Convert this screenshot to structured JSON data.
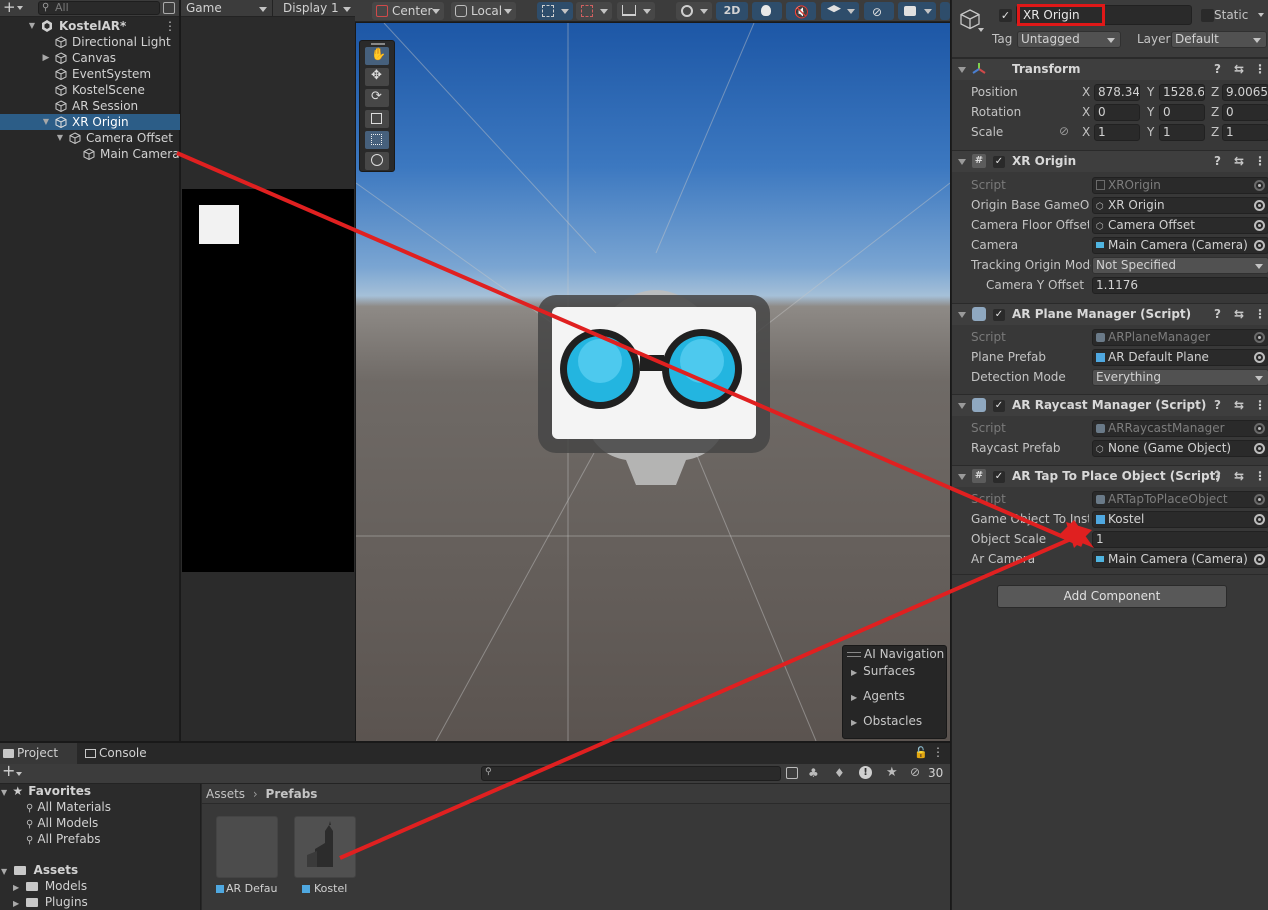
{
  "hierarchy": {
    "search_placeholder": "All",
    "scene_name": "KostelAR*",
    "items": [
      {
        "label": "Directional Light"
      },
      {
        "label": "Canvas"
      },
      {
        "label": "EventSystem"
      },
      {
        "label": "KostelScene"
      },
      {
        "label": "AR Session"
      },
      {
        "label": "XR Origin"
      },
      {
        "label": "Camera Offset"
      },
      {
        "label": "Main Camera"
      }
    ]
  },
  "game_view": {
    "tab": "Game",
    "display": "Display 1"
  },
  "scene_toolbar": {
    "pivot": "Center",
    "space": "Local",
    "mode_2d": "2D"
  },
  "ai_navigation": {
    "title": "AI Navigation",
    "items": [
      "Surfaces",
      "Agents",
      "Obstacles"
    ]
  },
  "inspector": {
    "object_name": "XR Origin",
    "static_label": "Static",
    "tag_label": "Tag",
    "tag_value": "Untagged",
    "layer_label": "Layer",
    "layer_value": "Default",
    "transform": {
      "title": "Transform",
      "position_label": "Position",
      "rotation_label": "Rotation",
      "scale_label": "Scale",
      "position": {
        "x": "878.34",
        "y": "1528.62",
        "z": "9.0065"
      },
      "rotation": {
        "x": "0",
        "y": "0",
        "z": "0"
      },
      "scale": {
        "x": "1",
        "y": "1",
        "z": "1"
      }
    },
    "xr_origin": {
      "title": "XR Origin",
      "script_label": "Script",
      "script_value": "XROrigin",
      "origin_label": "Origin Base GameObj",
      "origin_value": "XR Origin",
      "floor_label": "Camera Floor Offset O",
      "floor_value": "Camera Offset",
      "camera_label": "Camera",
      "camera_value": "Main Camera (Camera)",
      "tracking_label": "Tracking Origin Mode",
      "tracking_value": "Not Specified",
      "yoffset_label": "Camera Y Offset",
      "yoffset_value": "1.1176"
    },
    "plane_manager": {
      "title": "AR Plane Manager (Script)",
      "script_label": "Script",
      "script_value": "ARPlaneManager",
      "prefab_label": "Plane Prefab",
      "prefab_value": "AR Default Plane",
      "detection_label": "Detection Mode",
      "detection_value": "Everything"
    },
    "raycast_manager": {
      "title": "AR Raycast Manager (Script)",
      "script_label": "Script",
      "script_value": "ARRaycastManager",
      "prefab_label": "Raycast Prefab",
      "prefab_value": "None (Game Object)"
    },
    "tap_to_place": {
      "title": "AR Tap To Place Object (Script)",
      "script_label": "Script",
      "script_value": "ARTapToPlaceObject",
      "go_label": "Game Object To Insta",
      "go_value": "Kostel",
      "scale_label": "Object Scale",
      "scale_value": "1",
      "camera_label": "Ar Camera",
      "camera_value": "Main Camera (Camera)"
    },
    "add_component": "Add Component"
  },
  "project": {
    "tab_project": "Project",
    "tab_console": "Console",
    "hidden_count": "30",
    "favorites": "Favorites",
    "fav_items": [
      "All Materials",
      "All Models",
      "All Prefabs"
    ],
    "assets": "Assets",
    "asset_folders": [
      "Models",
      "Plugins"
    ],
    "breadcrumb_root": "Assets",
    "breadcrumb_current": "Prefabs",
    "files": [
      {
        "name": "AR Default..."
      },
      {
        "name": "Kostel"
      }
    ]
  },
  "colors": {
    "selection": "#2c5d87",
    "annotation_red": "#e02020",
    "panel": "#383838",
    "sky_top": "#1d57a6"
  }
}
